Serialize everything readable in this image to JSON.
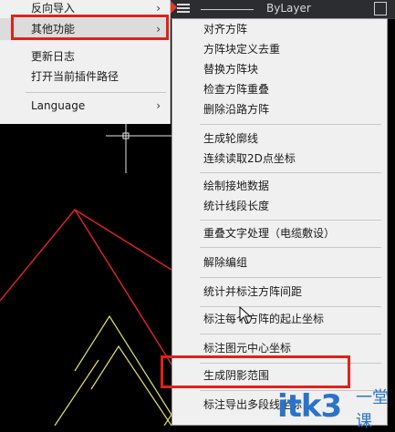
{
  "left_menu": {
    "items": [
      {
        "label": "反向导入",
        "arrow": "›"
      },
      {
        "label": "其他功能",
        "arrow": "›"
      },
      {
        "label": "更新日志",
        "arrow": ""
      },
      {
        "label": "打开当前插件路径",
        "arrow": ""
      },
      {
        "label": "Language",
        "arrow": "›"
      }
    ]
  },
  "toolbar": {
    "linetype_text": "ByLayer"
  },
  "submenu": {
    "items": [
      "对齐方阵",
      "方阵块定义去重",
      "替换方阵块",
      "检查方阵重叠",
      "删除沿路方阵",
      "生成轮廓线",
      "连续读取2D点坐标",
      "绘制接地数据",
      "统计线段长度",
      "重叠文字处理（电缆敷设）",
      "解除编组",
      "统计并标注方阵间距",
      "标注每个方阵的起止坐标",
      "标注图元中心坐标",
      "生成阴影范围",
      "标注导出多段线坐标"
    ]
  },
  "watermark": {
    "main": "itk3",
    "sub": "一堂课"
  },
  "colors": {
    "highlight_border": "#e32019",
    "menu_bg": "#f0f0f0",
    "canvas_bg": "#000000",
    "red_line": "#d9232a",
    "yellow_line": "#e6e36a",
    "watermark": "#2b73c9"
  }
}
